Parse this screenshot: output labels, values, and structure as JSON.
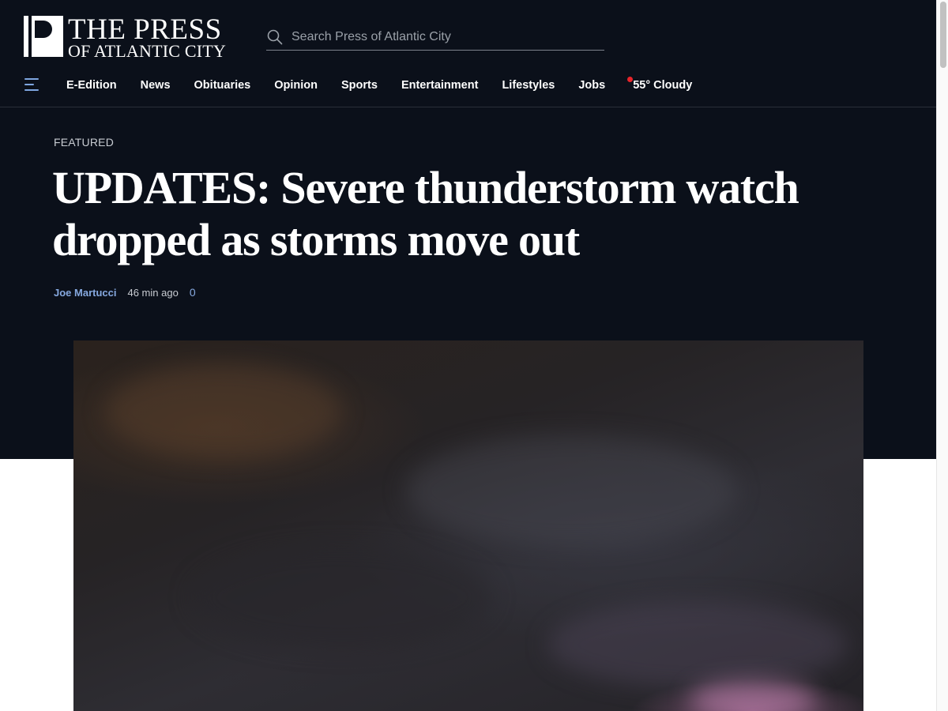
{
  "header": {
    "logo_line1": "THE PRESS",
    "logo_line2": "OF ATLANTIC CITY",
    "search_placeholder": "Search Press of Atlantic City"
  },
  "nav": {
    "items": [
      "E-Edition",
      "News",
      "Obituaries",
      "Opinion",
      "Sports",
      "Entertainment",
      "Lifestyles",
      "Jobs"
    ],
    "weather": "55° Cloudy"
  },
  "article": {
    "kicker": "FEATURED",
    "headline": "UPDATES: Severe thunderstorm watch dropped as storms move out",
    "author": "Joe Martucci",
    "time": "46 min ago",
    "comments": "0"
  },
  "colors": {
    "header_bg": "#0b101a",
    "link_blue": "#86a9e0",
    "alert_red": "#e8242a"
  },
  "icons": {
    "menu": "hamburger-menu-icon",
    "search": "search-icon",
    "weather_alert": "alert-dot-icon"
  }
}
